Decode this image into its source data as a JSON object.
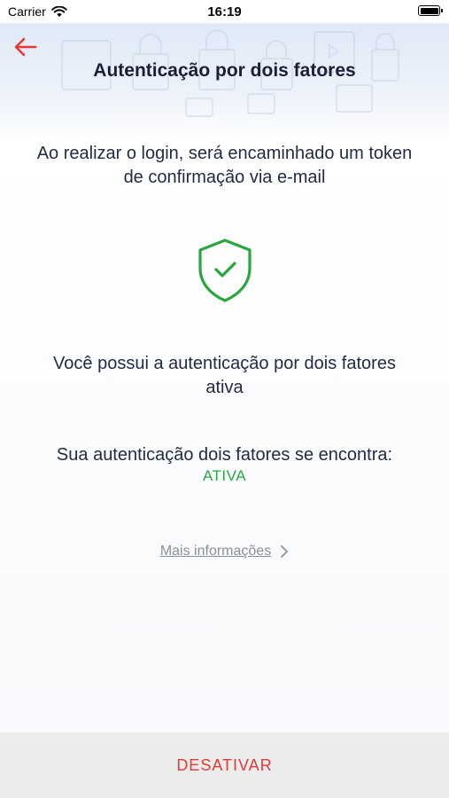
{
  "status_bar": {
    "carrier": "Carrier",
    "time": "16:19"
  },
  "header": {
    "title": "Autenticação por dois fatores",
    "back_icon": "arrow-left-icon",
    "accent_color": "#e53935"
  },
  "main": {
    "intro": "Ao realizar o login, será encaminhado um token de confirmação via e-mail",
    "shield_icon": "shield-check-icon",
    "shield_color": "#2aa63f",
    "status_message": "Você possui a autenticação por dois fatores ativa",
    "state_label": "Sua autenticação dois fatores se encontra:",
    "state_value": "ATIVA",
    "more_info_label": "Mais informações",
    "more_info_icon": "chevron-right-icon"
  },
  "footer": {
    "deactivate_label": "DESATIVAR"
  }
}
